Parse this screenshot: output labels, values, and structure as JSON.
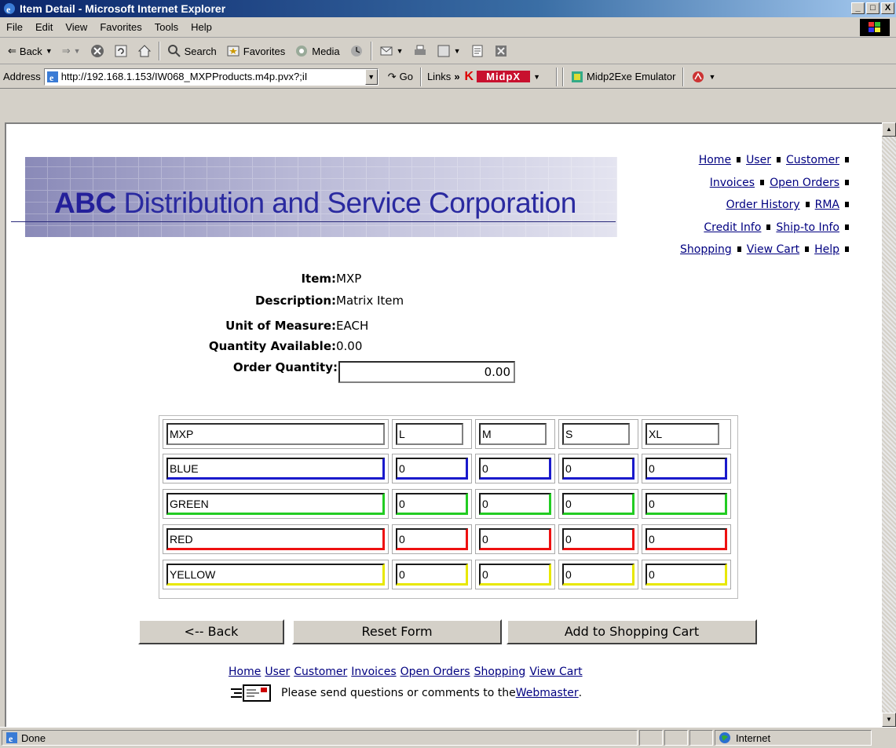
{
  "window": {
    "title": "Item Detail - Microsoft Internet Explorer",
    "min": "_",
    "max": "□",
    "close": "X"
  },
  "menu": [
    "File",
    "Edit",
    "View",
    "Favorites",
    "Tools",
    "Help"
  ],
  "toolbar": {
    "back": "Back",
    "search": "Search",
    "favorites": "Favorites",
    "media": "Media"
  },
  "address": {
    "label": "Address",
    "url": "http://192.168.1.153/IW068_MXPProducts.m4p.pvx?;iI",
    "go": "Go",
    "links": "Links",
    "midpx": "MidpX",
    "emulator": "Midp2Exe Emulator"
  },
  "banner": {
    "abc": "ABC",
    "title": "Distribution and Service Corporation"
  },
  "nav": {
    "rows": [
      [
        "Home",
        "User",
        "Customer"
      ],
      [
        "Invoices",
        "Open Orders"
      ],
      [
        "Order History",
        "RMA"
      ],
      [
        "Credit Info",
        "Ship-to Info"
      ],
      [
        "Shopping",
        "View Cart",
        "Help"
      ]
    ]
  },
  "item": {
    "item_label": "Item:",
    "item_value": "MXP",
    "desc_label": "Description:",
    "desc_value": "Matrix Item",
    "uom_label": "Unit of Measure:",
    "uom_value": "EACH",
    "qty_avail_label": "Quantity Available:",
    "qty_avail_value": "0.00",
    "order_qty_label": "Order Quantity:",
    "order_qty_value": "0.00"
  },
  "matrix": {
    "corner": "MXP",
    "sizes": [
      "L",
      "M",
      "S",
      "XL"
    ],
    "rows": [
      {
        "color": "BLUE",
        "hex": "#1a1acc",
        "values": [
          "0",
          "0",
          "0",
          "0"
        ]
      },
      {
        "color": "GREEN",
        "hex": "#22cc22",
        "values": [
          "0",
          "0",
          "0",
          "0"
        ]
      },
      {
        "color": "RED",
        "hex": "#ee1111",
        "values": [
          "0",
          "0",
          "0",
          "0"
        ]
      },
      {
        "color": "YELLOW",
        "hex": "#e8e800",
        "values": [
          "0",
          "0",
          "0",
          "0"
        ]
      }
    ]
  },
  "buttons": {
    "back": "<-- Back",
    "reset": "Reset Form",
    "add": "Add to Shopping Cart"
  },
  "footer": {
    "links": [
      "Home",
      "User",
      "Customer",
      "Invoices",
      "Open Orders",
      "Shopping",
      "View Cart"
    ],
    "msg": "Please send questions or comments to the ",
    "webmaster": "Webmaster",
    "period": "."
  },
  "status": {
    "text": "Done",
    "zone": "Internet"
  }
}
